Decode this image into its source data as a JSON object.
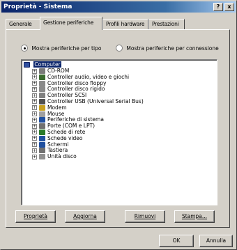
{
  "window": {
    "title": "Proprietà - Sistema",
    "help_button": "?",
    "close_button": "x"
  },
  "tabs": [
    "Generale",
    "Gestione periferiche",
    "Profili hardware",
    "Prestazioni"
  ],
  "view_options": [
    {
      "label": "Mostra periferiche per tipo",
      "selected": true
    },
    {
      "label": "Mostra periferiche per connessione",
      "selected": false
    }
  ],
  "tree": {
    "root": {
      "label": "Computer",
      "icon": "computer-icon"
    },
    "items": [
      {
        "label": "CD-ROM",
        "icon": "cdrom-icon",
        "color": "#7a7a7a"
      },
      {
        "label": "Controller audio, video e giochi",
        "icon": "audio-icon",
        "color": "#3a6b2f"
      },
      {
        "label": "Controller disco floppy",
        "icon": "floppy-icon",
        "color": "#8a8a8a"
      },
      {
        "label": "Controller disco rigido",
        "icon": "harddisk-icon",
        "color": "#8a8a8a"
      },
      {
        "label": "Controller SCSI",
        "icon": "scsi-icon",
        "color": "#808080"
      },
      {
        "label": "Controller USB (Universal Serial Bus)",
        "icon": "usb-icon",
        "color": "#505050"
      },
      {
        "label": "Modem",
        "icon": "modem-icon",
        "color": "#c8a020"
      },
      {
        "label": "Mouse",
        "icon": "mouse-icon",
        "color": "#a0a0a0"
      },
      {
        "label": "Periferiche di sistema",
        "icon": "system-device-icon",
        "color": "#2050a0"
      },
      {
        "label": "Porte (COM e LPT)",
        "icon": "port-icon",
        "color": "#707070"
      },
      {
        "label": "Schede di rete",
        "icon": "network-card-icon",
        "color": "#2a7a2a"
      },
      {
        "label": "Schede video",
        "icon": "video-card-icon",
        "color": "#2050a0"
      },
      {
        "label": "Schermi",
        "icon": "monitor-icon",
        "color": "#2050a0"
      },
      {
        "label": "Tastiera",
        "icon": "keyboard-icon",
        "color": "#707070"
      },
      {
        "label": "Unità disco",
        "icon": "disk-drive-icon",
        "color": "#909090"
      }
    ]
  },
  "action_buttons": [
    "Proprietà",
    "Aggiorna",
    "Rimuovi",
    "Stampa..."
  ],
  "dialog_buttons": [
    "OK",
    "Annulla"
  ]
}
